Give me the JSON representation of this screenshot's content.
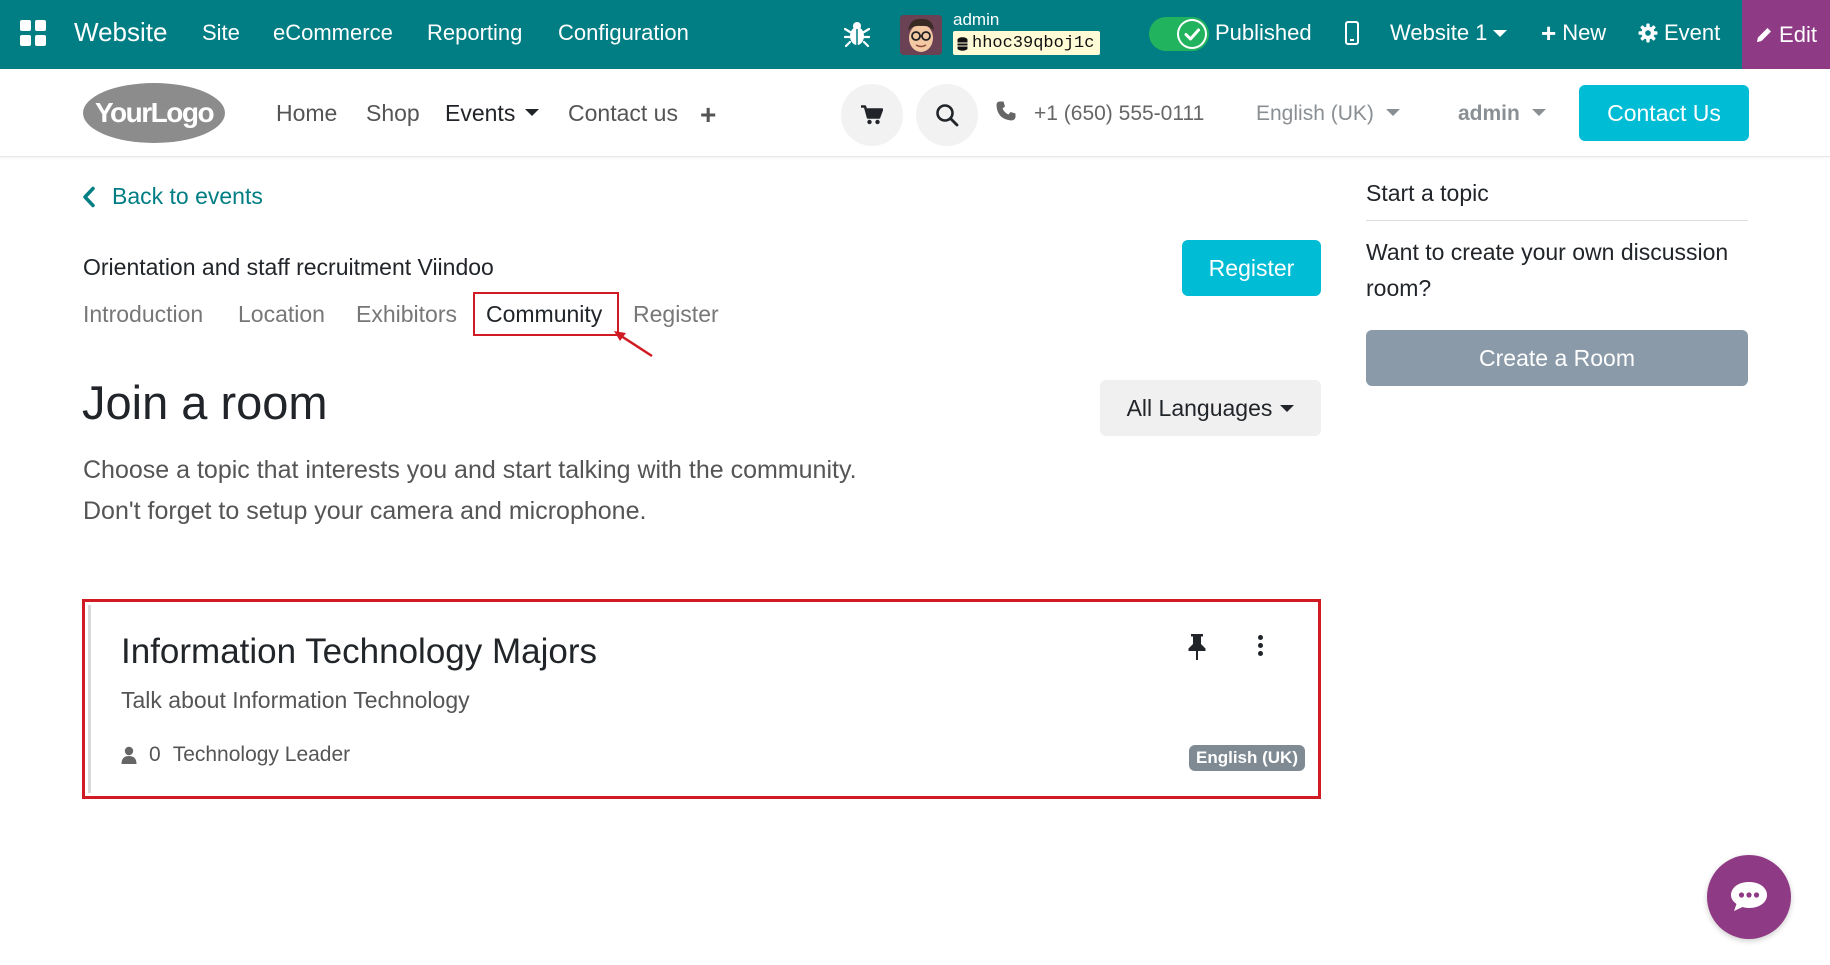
{
  "admin_bar": {
    "brand": "Website",
    "menus": [
      "Site",
      "eCommerce",
      "Reporting",
      "Configuration"
    ],
    "user_name": "admin",
    "database": "hhoc39qboj1c",
    "published_label": "Published",
    "website_selector": "Website 1",
    "new_label": "New",
    "event_label": "Event",
    "edit_label": "Edit"
  },
  "site_header": {
    "logo_text": "YourLogo",
    "nav": [
      "Home",
      "Shop",
      "Events",
      "Contact us"
    ],
    "phone": "+1 (650) 555-0111",
    "language": "English (UK)",
    "user": "admin",
    "contact_button": "Contact Us"
  },
  "event": {
    "back_link": "Back to events",
    "title": "Orientation and staff recruitment Viindoo",
    "register_button": "Register",
    "tabs": [
      "Introduction",
      "Location",
      "Exhibitors",
      "Community",
      "Register"
    ],
    "active_tab": "Community"
  },
  "community": {
    "heading": "Join a room",
    "language_filter": "All Languages",
    "description_line1": "Choose a topic that interests you and start talking with the community.",
    "description_line2": "Don't forget to setup your camera and microphone."
  },
  "room": {
    "name": "Information Technology Majors",
    "subtitle": "Talk about Information Technology",
    "participants": "0",
    "audience": "Technology Leader",
    "language": "English (UK)"
  },
  "sidebar": {
    "title": "Start a topic",
    "text": "Want to create your own discussion room?",
    "create_button": "Create a Room"
  },
  "colors": {
    "admin_bar": "#017e84",
    "edit_button": "#8f3a84",
    "primary": "#00bcd4",
    "highlight": "#d11b24"
  }
}
